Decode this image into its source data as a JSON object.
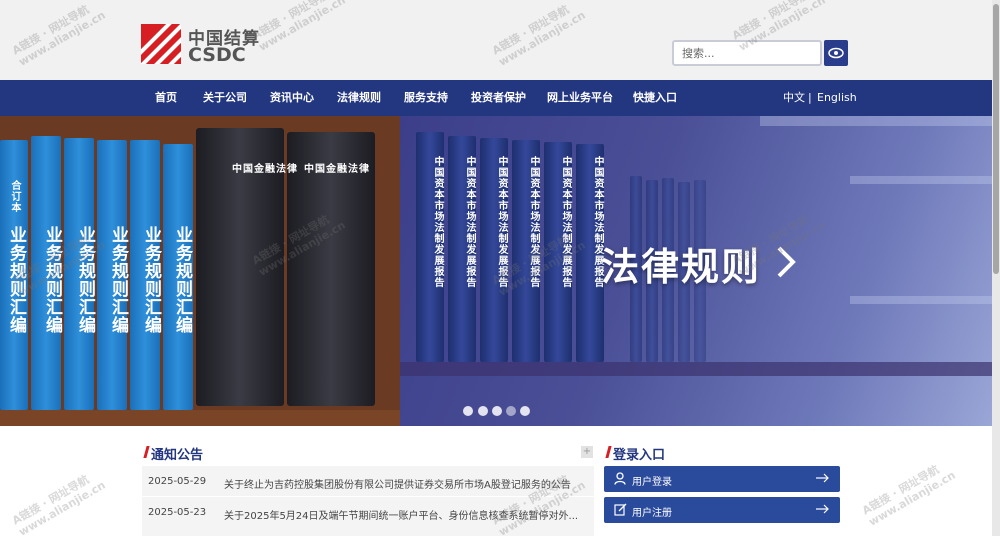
{
  "header": {
    "logo_cn": "中国结算",
    "logo_en": "CSDC",
    "search_placeholder": "搜索..."
  },
  "nav": {
    "items": [
      "首页",
      "关于公司",
      "资讯中心",
      "法律规则",
      "服务支持",
      "投资者保护",
      "网上业务平台",
      "快捷入口"
    ],
    "lang_cn": "中文",
    "lang_sep": "|",
    "lang_en": "English"
  },
  "banner": {
    "title": "法律规则",
    "left_book_label": "合订本",
    "left_book_title": "业务规则汇编",
    "dark_book_title": "中国金融法律",
    "navy_book_title": "中国资本市场法制发展报告",
    "slides_total": 5
  },
  "notices": {
    "title": "通知公告",
    "more": "+",
    "items": [
      {
        "date": "2025-05-29",
        "text": "关于终止为吉药控股集团股份有限公司提供证券交易所市场A股登记服务的公告"
      },
      {
        "date": "2025-05-23",
        "text": "关于2025年5月24日及端午节期间统一账户平台、身份信息核查系统暂停对外..."
      }
    ]
  },
  "login": {
    "title": "登录入口",
    "user_login": "用户登录",
    "user_register": "用户注册"
  },
  "watermark": {
    "line1": "A链接 · 网址导航",
    "line2": "www.alianjie.cn"
  },
  "colors": {
    "nav_bg": "#233680",
    "brand_red": "#d71e23",
    "login_btn": "#2a4a9c"
  }
}
